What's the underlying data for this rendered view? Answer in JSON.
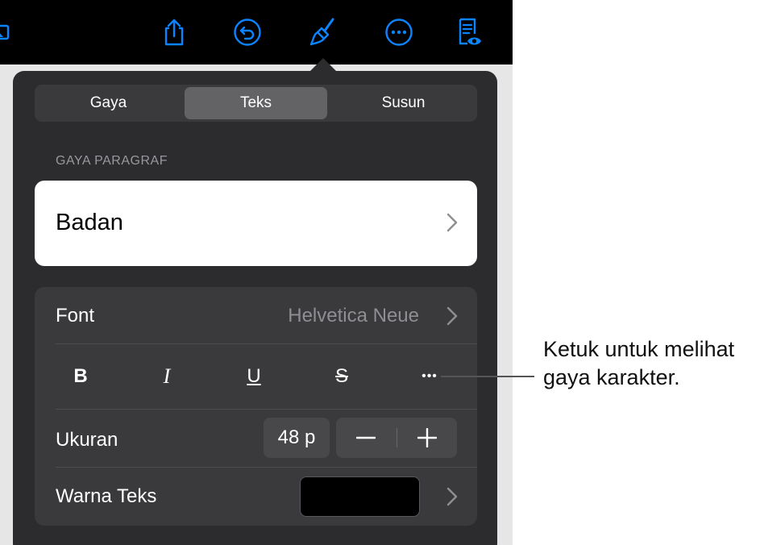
{
  "toolbar": {
    "icons": [
      "share-icon",
      "undo-icon",
      "format-brush-icon",
      "more-icon",
      "document-view-icon"
    ],
    "accent": "#0a84ff"
  },
  "tabs": [
    {
      "label": "Gaya",
      "active": false
    },
    {
      "label": "Teks",
      "active": true
    },
    {
      "label": "Susun",
      "active": false
    }
  ],
  "paragraph_style": {
    "section_label": "GAYA PARAGRAF",
    "value": "Badan"
  },
  "font": {
    "label": "Font",
    "value": "Helvetica Neue"
  },
  "char_styles": {
    "bold": "B",
    "italic": "I",
    "underline": "U",
    "strike": "S",
    "more": "•••"
  },
  "size": {
    "label": "Ukuran",
    "value": "48 p",
    "decrement": "−",
    "increment": "+"
  },
  "text_color": {
    "label": "Warna Teks",
    "color": "#000000"
  },
  "callout": {
    "line1": "Ketuk untuk melihat",
    "line2": "gaya karakter."
  }
}
